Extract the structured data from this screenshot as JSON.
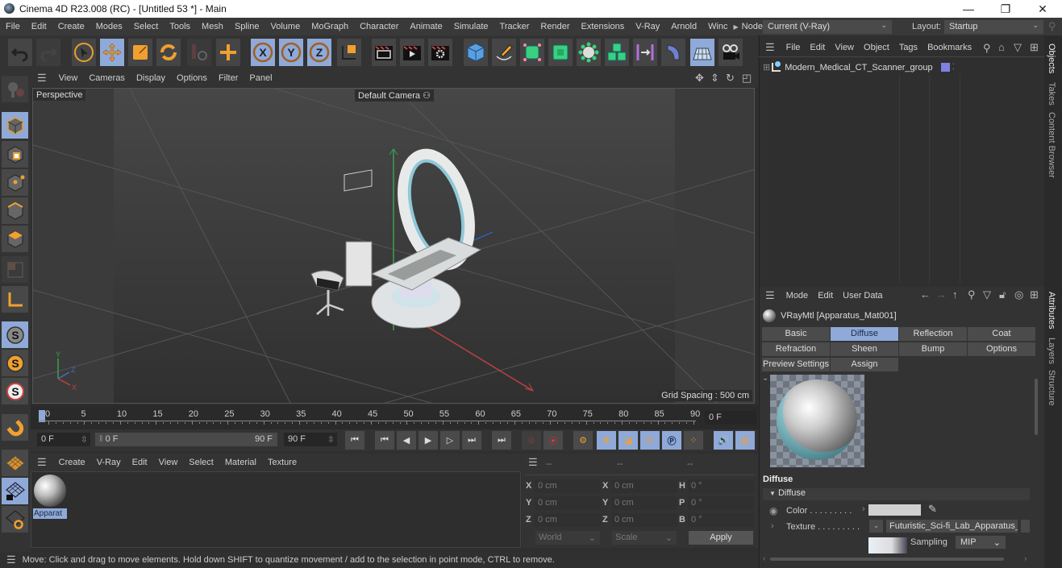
{
  "window": {
    "title": "Cinema 4D R23.008 (RC) - [Untitled 53 *] - Main",
    "controls": {
      "minimize": "—",
      "maximize": "❐",
      "close": "✕"
    }
  },
  "menubar": {
    "items": [
      "File",
      "Edit",
      "Create",
      "Modes",
      "Select",
      "Tools",
      "Mesh",
      "Spline",
      "Volume",
      "MoGraph",
      "Character",
      "Animate",
      "Simulate",
      "Tracker",
      "Render",
      "Extensions",
      "V-Ray",
      "Arnold",
      "Winc"
    ],
    "node_space_label": "Node Space:",
    "node_space_value": "Current (V-Ray)",
    "layout_label": "Layout:",
    "layout_value": "Startup"
  },
  "toolbar": {
    "icons": [
      "undo-icon",
      "redo-icon",
      "select-icon",
      "move-icon",
      "scale-icon",
      "rotate-icon",
      "recent-tools-icon",
      "add-object-icon",
      "x-axis-icon",
      "y-axis-icon",
      "z-axis-icon",
      "coordinate-system-icon",
      "render-view-icon",
      "render-picture-viewer-icon",
      "render-settings-icon",
      "cube-icon",
      "pen-icon",
      "subdivision-icon",
      "extrude-icon",
      "cloner-icon",
      "array-icon",
      "symmetry-icon",
      "deformer-icon",
      "floor-icon",
      "camera-icon"
    ]
  },
  "viewport": {
    "menu": [
      "View",
      "Cameras",
      "Display",
      "Options",
      "Filter",
      "Panel"
    ],
    "label": "Perspective",
    "camera": "Default Camera",
    "grid_spacing": "Grid Spacing : 500 cm",
    "axis": {
      "x": "X",
      "y": "Y",
      "z": "Z"
    }
  },
  "timeline": {
    "ticks": [
      "0",
      "5",
      "10",
      "15",
      "20",
      "25",
      "30",
      "35",
      "40",
      "45",
      "50",
      "55",
      "60",
      "65",
      "70",
      "75",
      "80",
      "85",
      "90"
    ],
    "current_frame": "0 F",
    "start_field": "0 F",
    "range_start": "0 F",
    "range_end": "90 F",
    "end_field": "90 F"
  },
  "material_manager": {
    "menu": [
      "Create",
      "V-Ray",
      "Edit",
      "View",
      "Select",
      "Material",
      "Texture"
    ],
    "materials": [
      {
        "name": "Apparat"
      }
    ]
  },
  "coordinates": {
    "headers": [
      "--",
      "--",
      "--"
    ],
    "rows": [
      {
        "pos_label": "X",
        "pos": "0 cm",
        "size_label": "X",
        "size": "0 cm",
        "rot_label": "H",
        "rot": "0 °"
      },
      {
        "pos_label": "Y",
        "pos": "0 cm",
        "size_label": "Y",
        "size": "0 cm",
        "rot_label": "P",
        "rot": "0 °"
      },
      {
        "pos_label": "Z",
        "pos": "0 cm",
        "size_label": "Z",
        "size": "0 cm",
        "rot_label": "B",
        "rot": "0 °"
      }
    ],
    "mode": "World",
    "scale_mode": "Scale",
    "apply_label": "Apply"
  },
  "status": {
    "text": "Move: Click and drag to move elements. Hold down SHIFT to quantize movement / add to the selection in point mode, CTRL to remove."
  },
  "objects_panel": {
    "menu": [
      "File",
      "Edit",
      "View",
      "Object",
      "Tags",
      "Bookmarks"
    ],
    "objects": [
      {
        "name": "Modern_Medical_CT_Scanner_group",
        "tag_color": "#8080e0"
      }
    ]
  },
  "attributes_panel": {
    "menu": [
      "Mode",
      "Edit",
      "User Data"
    ],
    "material_title": "VRayMtl [Apparatus_Mat001]",
    "tabs": [
      {
        "label": "Basic",
        "selected": false
      },
      {
        "label": "Diffuse",
        "selected": true
      },
      {
        "label": "Reflection",
        "selected": false
      },
      {
        "label": "Coat",
        "selected": false
      },
      {
        "label": "Refraction",
        "selected": false
      },
      {
        "label": "Sheen",
        "selected": false
      },
      {
        "label": "Bump",
        "selected": false
      },
      {
        "label": "Options",
        "selected": false
      },
      {
        "label": "Preview Settings",
        "selected": false
      },
      {
        "label": "Assign",
        "selected": false
      }
    ],
    "section_title": "Diffuse",
    "group_title": "Diffuse",
    "color_label": "Color . . . . . . . . .",
    "color_value": "#d0d0d0",
    "texture_label": "Texture . . . . . . . . .",
    "texture_value": "Futuristic_Sci-fi_Lab_Apparatus_B",
    "sampling_label": "Sampling",
    "sampling_value": "MIP"
  },
  "side_tabs": {
    "top": [
      "Objects",
      "Takes",
      "Content Browser"
    ],
    "bottom": [
      "Attributes",
      "Layers",
      "Structure"
    ]
  },
  "colors": {
    "accent": "#8fa9d8",
    "orange": "#f0a030",
    "background": "#333333"
  }
}
